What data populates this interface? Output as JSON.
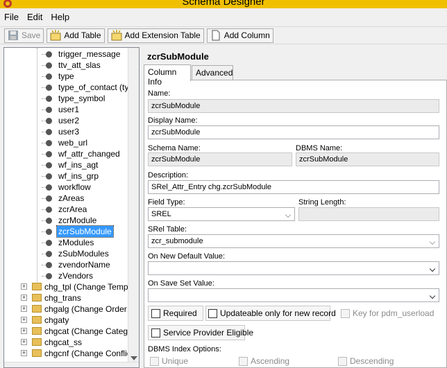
{
  "window": {
    "title": "Schema Designer"
  },
  "menu": [
    "File",
    "Edit",
    "Help"
  ],
  "toolbar": {
    "save": "Save",
    "add_table": "Add Table",
    "add_extension_table": "Add Extension Table",
    "add_column": "Add Column"
  },
  "tree": {
    "leaves": [
      "trigger_message",
      "ttv_att_slas",
      "type",
      "type_of_contact (typ",
      "type_symbol",
      "user1",
      "user2",
      "user3",
      "web_url",
      "wf_attr_changed",
      "wf_ins_agt",
      "wf_ins_grp",
      "workflow",
      "zAreas",
      "zcrArea",
      "zcrModule",
      "zcrSubModule",
      "zModules",
      "zSubModules",
      "zvendorName",
      "zVendors"
    ],
    "selected_index": 16,
    "folders": [
      "chg_tpl (Change Template",
      "chg_trans",
      "chgalg (Change Order Act",
      "chgaty",
      "chgcat (Change Category",
      "chgcat_ss",
      "chgcnf (Change Conflict)"
    ]
  },
  "panel": {
    "title": "zcrSubModule",
    "tabs": [
      "Column Info",
      "Advanced"
    ],
    "name_label": "Name:",
    "name_value": "zcrSubModule",
    "display_name_label": "Display Name:",
    "display_name_value": "zcrSubModule",
    "schema_name_label": "Schema Name:",
    "schema_name_value": "zcrSubModule",
    "dbms_name_label": "DBMS Name:",
    "dbms_name_value": "zcrSubModule",
    "description_label": "Description:",
    "description_value": "SRel_Attr_Entry chg.zcrSubModule",
    "field_type_label": "Field Type:",
    "field_type_value": "SREL",
    "string_length_label": "String Length:",
    "string_length_value": "",
    "srel_table_label": "SRel Table:",
    "srel_table_value": "zcr_submodule",
    "on_new_default_label": "On New Default Value:",
    "on_new_default_value": "",
    "on_save_set_label": "On Save Set Value:",
    "on_save_set_value": "",
    "required_label": "Required",
    "updateable_label": "Updateable only for new record",
    "key_label": "Key for pdm_userload",
    "service_provider_label": "Service Provider Eligible",
    "dbms_index_label": "DBMS Index Options:",
    "unique_label": "Unique",
    "ascending_label": "Ascending",
    "descending_label": "Descending"
  }
}
